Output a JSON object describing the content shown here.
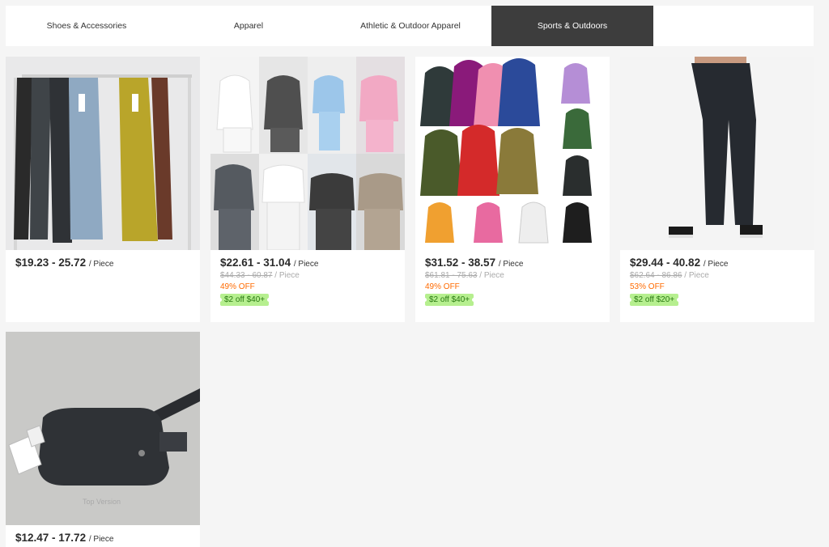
{
  "tabs": [
    {
      "label": "Shoes & Accessories",
      "active": false
    },
    {
      "label": "Apparel",
      "active": false
    },
    {
      "label": "Athletic & Outdoor Apparel",
      "active": false
    },
    {
      "label": "Sports & Outdoors",
      "active": true
    }
  ],
  "products": [
    {
      "price": "$19.23 - 25.72",
      "unit": "/ Piece",
      "image": "flared leggings on rack"
    },
    {
      "price": "$22.61 - 31.04",
      "unit": "/ Piece",
      "original_price": "$44.33 - 60.87",
      "original_unit": "/ Piece",
      "discount": "49% OFF",
      "coupon": "$2 off $40+",
      "image": "hoodie tracksuit sets collage"
    },
    {
      "price": "$31.52 - 38.57",
      "unit": "/ Piece",
      "original_price": "$61.81 - 75.63",
      "original_unit": "/ Piece",
      "discount": "49% OFF",
      "coupon": "$2 off $40+",
      "image": "camo hoodies grid"
    },
    {
      "price": "$29.44 - 40.82",
      "unit": "/ Piece",
      "original_price": "$62.64 - 86.86",
      "original_unit": "/ Piece",
      "discount": "53% OFF",
      "coupon": "$2 off $20+",
      "image": "black jogger pants"
    },
    {
      "price": "$12.47 - 17.72",
      "unit": "/ Piece",
      "image": "black belt bag",
      "watermark": "Top Version"
    }
  ],
  "colors": {
    "active_tab": "#3d3d3d",
    "discount": "#ff6a00",
    "coupon_bg": "#b6ef8f",
    "coupon_text": "#2a7a12"
  }
}
